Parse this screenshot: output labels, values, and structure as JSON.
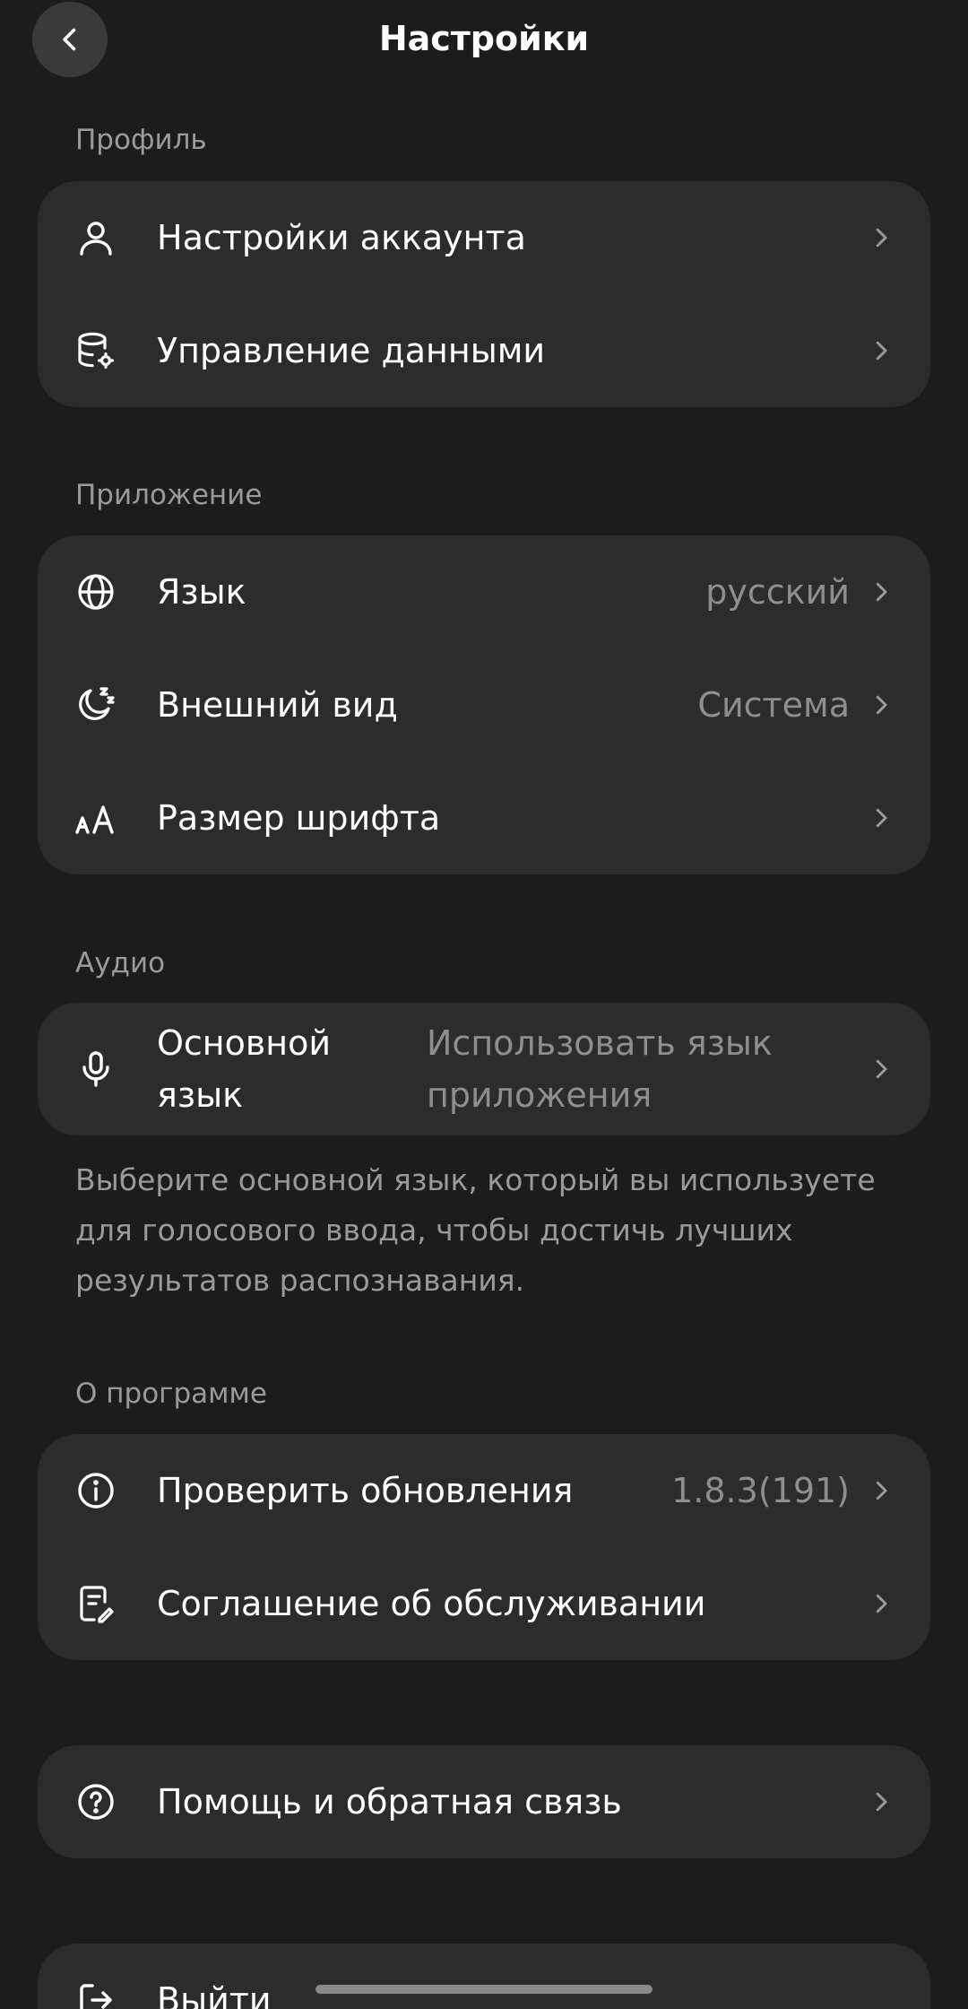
{
  "header": {
    "title": "Настройки"
  },
  "sections": {
    "profile": {
      "label": "Профиль",
      "items": [
        {
          "label": "Настройки аккаунта",
          "icon": "user-icon"
        },
        {
          "label": "Управление данными",
          "icon": "database-settings-icon"
        }
      ]
    },
    "app": {
      "label": "Приложение",
      "items": [
        {
          "label": "Язык",
          "value": "русский",
          "icon": "globe-icon"
        },
        {
          "label": "Внешний вид",
          "value": "Система",
          "icon": "moon-icon"
        },
        {
          "label": "Размер шрифта",
          "icon": "font-size-icon"
        }
      ]
    },
    "audio": {
      "label": "Аудио",
      "items": [
        {
          "label": "Основной язык",
          "value": "Использовать язык приложения",
          "icon": "microphone-icon"
        }
      ],
      "note": "Выберите основной язык, который вы используете для голосового ввода, чтобы достичь лучших результатов распознавания."
    },
    "about": {
      "label": "О программе",
      "items": [
        {
          "label": "Проверить обновления",
          "value": "1.8.3(191)",
          "icon": "info-icon"
        },
        {
          "label": "Соглашение об обслуживании",
          "icon": "document-edit-icon"
        }
      ]
    },
    "help": {
      "items": [
        {
          "label": "Помощь и обратная связь",
          "icon": "help-circle-icon"
        }
      ]
    },
    "logout": {
      "items": [
        {
          "label": "Выйти",
          "icon": "logout-icon"
        }
      ]
    }
  },
  "colors": {
    "background": "#1c1c1c",
    "card": "#2c2c2c",
    "text": "#ffffff",
    "secondary_text": "#9a9a9a"
  }
}
